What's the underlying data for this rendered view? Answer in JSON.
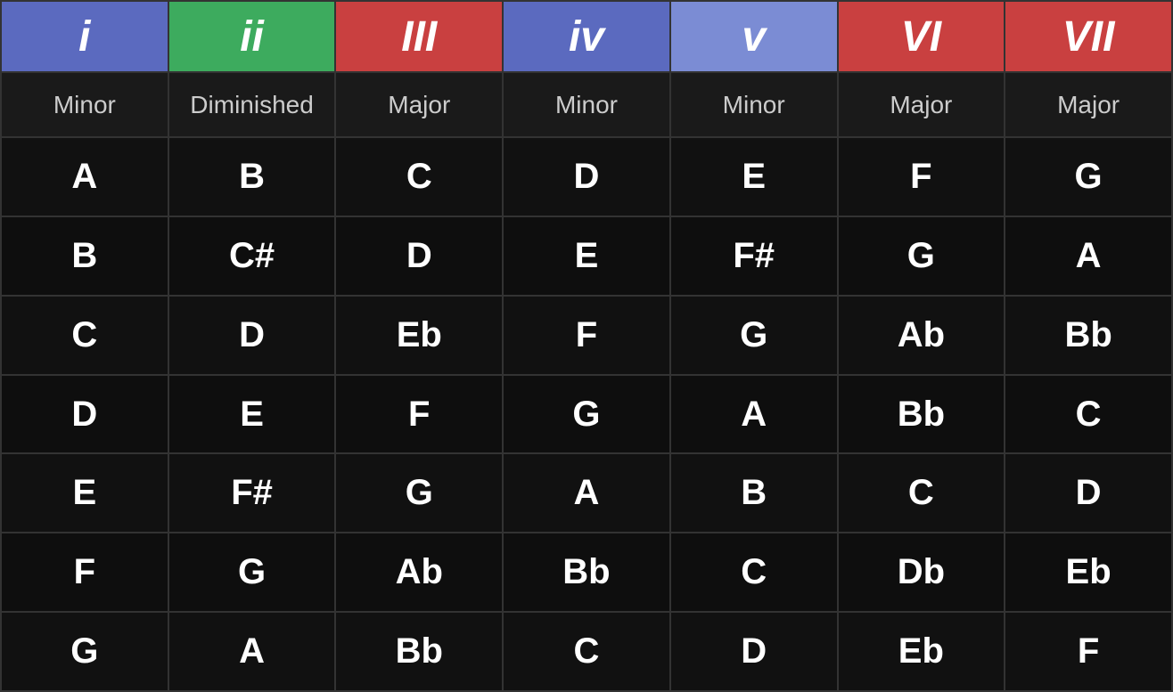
{
  "headers": [
    {
      "label": "i",
      "class": "header-i"
    },
    {
      "label": "ii",
      "class": "header-ii"
    },
    {
      "label": "III",
      "class": "header-iii"
    },
    {
      "label": "iv",
      "class": "header-iv"
    },
    {
      "label": "v",
      "class": "header-v"
    },
    {
      "label": "VI",
      "class": "header-vi"
    },
    {
      "label": "VII",
      "class": "header-vii"
    }
  ],
  "qualities": [
    "Minor",
    "Diminished",
    "Major",
    "Minor",
    "Minor",
    "Major",
    "Major"
  ],
  "rows": [
    [
      "A",
      "B",
      "C",
      "D",
      "E",
      "F",
      "G"
    ],
    [
      "B",
      "C#",
      "D",
      "E",
      "F#",
      "G",
      "A"
    ],
    [
      "C",
      "D",
      "Eb",
      "F",
      "G",
      "Ab",
      "Bb"
    ],
    [
      "D",
      "E",
      "F",
      "G",
      "A",
      "Bb",
      "C"
    ],
    [
      "E",
      "F#",
      "G",
      "A",
      "B",
      "C",
      "D"
    ],
    [
      "F",
      "G",
      "Ab",
      "Bb",
      "C",
      "Db",
      "Eb"
    ],
    [
      "G",
      "A",
      "Bb",
      "C",
      "D",
      "Eb",
      "F"
    ]
  ]
}
